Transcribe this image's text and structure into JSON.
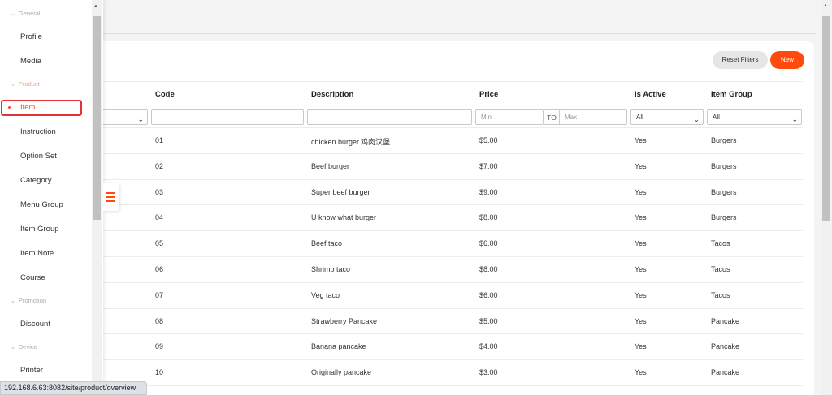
{
  "sidebar": {
    "sections": [
      {
        "label": "General"
      },
      {
        "label": "Product"
      },
      {
        "label": "Promotion"
      },
      {
        "label": "Device"
      }
    ],
    "items": [
      {
        "label": "Profile"
      },
      {
        "label": "Media"
      },
      {
        "label": "Item"
      },
      {
        "label": "Instruction"
      },
      {
        "label": "Option Set"
      },
      {
        "label": "Category"
      },
      {
        "label": "Menu Group"
      },
      {
        "label": "Item Group"
      },
      {
        "label": "Item Note"
      },
      {
        "label": "Course"
      },
      {
        "label": "Discount"
      },
      {
        "label": "Printer"
      }
    ]
  },
  "toolbar": {
    "reset_label": "Reset Filters",
    "new_label": "New"
  },
  "table": {
    "headers": {
      "code": "Code",
      "description": "Description",
      "price": "Price",
      "active": "Is Active",
      "group": "Item Group"
    },
    "filters": {
      "price_min_placeholder": "Min",
      "price_to": "TO",
      "price_max_placeholder": "Max",
      "active_value": "All",
      "group_value": "All"
    },
    "rows": [
      {
        "code": "01",
        "description": "chicken burger.鸡肉汉堡",
        "price": "$5.00",
        "active": "Yes",
        "group": "Burgers"
      },
      {
        "code": "02",
        "description": "Beef burger",
        "price": "$7.00",
        "active": "Yes",
        "group": "Burgers"
      },
      {
        "code": "03",
        "description": "Super beef burger",
        "price": "$9.00",
        "active": "Yes",
        "group": "Burgers"
      },
      {
        "code": "04",
        "description": "U know what burger",
        "price": "$8.00",
        "active": "Yes",
        "group": "Burgers"
      },
      {
        "code": "05",
        "description": "Beef taco",
        "price": "$6.00",
        "active": "Yes",
        "group": "Tacos"
      },
      {
        "code": "06",
        "description": "Shrimp taco",
        "price": "$8.00",
        "active": "Yes",
        "group": "Tacos"
      },
      {
        "code": "07",
        "description": "Veg taco",
        "price": "$6.00",
        "active": "Yes",
        "group": "Tacos"
      },
      {
        "code": "08",
        "description": "Strawberry Pancake",
        "price": "$5.00",
        "active": "Yes",
        "group": "Pancake"
      },
      {
        "code": "09",
        "description": "Banana pancake",
        "price": "$4.00",
        "active": "Yes",
        "group": "Pancake"
      },
      {
        "code": "10",
        "description": "Originally pancake",
        "price": "$3.00",
        "active": "Yes",
        "group": "Pancake"
      }
    ]
  },
  "status_url": "192.168.6.63:8082/site/product/overview"
}
